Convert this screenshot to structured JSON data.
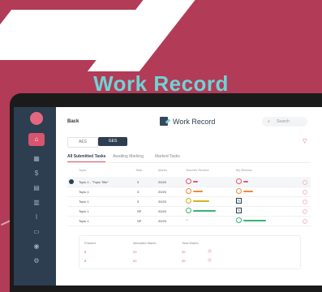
{
  "hero": {
    "headline": "Work Record"
  },
  "colors": {
    "brand": "#b23b57",
    "accent": "#6fd3d6",
    "sidebar": "#2c3e50",
    "highlight": "#e05a70"
  },
  "sidebar": {
    "icons": [
      "home-icon",
      "calendar-icon",
      "dollar-icon",
      "chart-icon",
      "book-icon",
      "attachment-icon",
      "document-icon",
      "chat-icon",
      "settings-icon"
    ]
  },
  "header": {
    "back_label": "Back",
    "title": "Work Record",
    "search_placeholder": "Search"
  },
  "grade_tabs": [
    "AES",
    "GES"
  ],
  "tabs": [
    "All Submitted Tasks",
    "Awaiting Marking",
    "Marked Tasks"
  ],
  "table": {
    "columns": [
      "Topic",
      "Task",
      "Marks",
      "Teacher Review",
      "My Review"
    ],
    "rows": [
      {
        "topic": "Topic 1 - \"Topic Title\"",
        "task": "3",
        "marks": "20/20"
      },
      {
        "topic": "Topic 1",
        "task": "3",
        "marks": "20/20"
      },
      {
        "topic": "Topic 1",
        "task": "3",
        "marks": "20/20"
      },
      {
        "topic": "Topic 1",
        "task": "SP",
        "marks": "20/20"
      },
      {
        "topic": "Topic 1",
        "task": "SP",
        "marks": "20/20"
      }
    ]
  },
  "summary": {
    "headers": [
      "Practice",
      "Allocated Marks",
      "Total Marks"
    ],
    "rows": [
      [
        "8",
        "20",
        "20"
      ],
      [
        "8",
        "20",
        "20"
      ]
    ]
  }
}
